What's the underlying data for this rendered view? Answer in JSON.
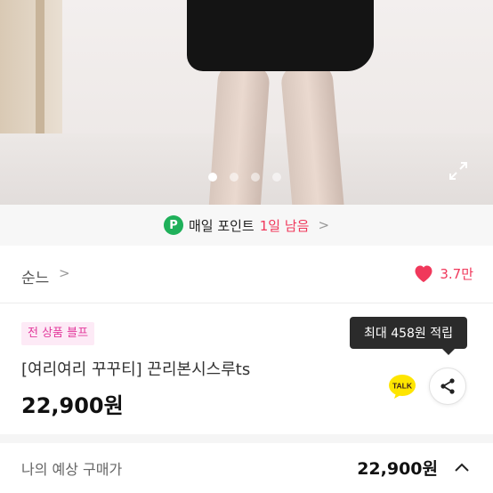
{
  "carousel": {
    "slide_count": 4,
    "active_index": 0
  },
  "point_bar": {
    "badge": "P",
    "text": "매일 포인트",
    "remaining": "1일 남음",
    "chevron": ">"
  },
  "seller": {
    "name": "순느",
    "chevron": ">",
    "likes": "3.7만"
  },
  "product": {
    "promo_tag": "전 상품 블프",
    "title": "[여리여리 꾸꾸티] 끈리본시스루ts",
    "price": "22,900원"
  },
  "tooltip": {
    "text": "최대 458원 적립"
  },
  "talk_button": {
    "label": "TALK"
  },
  "estimate": {
    "label": "나의 예상 구매가",
    "price": "22,900원"
  },
  "colors": {
    "accent": "#f0385b",
    "point_green": "#1fb05a",
    "promo_pink": "#e2389b",
    "talk_yellow": "#fee500"
  }
}
